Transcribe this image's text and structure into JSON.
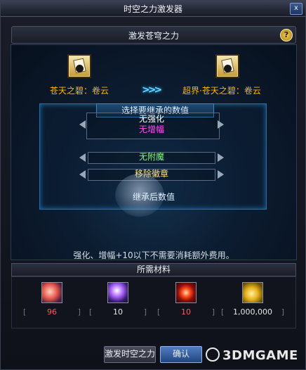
{
  "window": {
    "title": "时空之力激发器",
    "close_label": "x"
  },
  "header": {
    "title": "激发苍穹之力",
    "help_label": "?"
  },
  "items": {
    "source": {
      "name": "苍天之碧：卷云"
    },
    "target": {
      "name": "超界·苍天之碧：卷云"
    },
    "arrow_label": ">>>"
  },
  "inherit": {
    "title": "选择要继承的数值",
    "rows": [
      {
        "label": "无强化",
        "color": "#ffffff"
      },
      {
        "label": "无增幅",
        "color": "#ff4df2"
      },
      {
        "label": "无附魔",
        "color": "#7cff6b"
      },
      {
        "label": "移除徽章",
        "color": "#ffe680"
      }
    ],
    "result_label": "继承后数值"
  },
  "note": "强化、增幅+10以下不需要消耗额外费用。",
  "materials": {
    "title": "所需材料",
    "items": [
      {
        "icon": "fire-crystal-icon",
        "count": "96",
        "count_color": "#ff5a5a"
      },
      {
        "icon": "purple-orb-icon",
        "count": "10",
        "count_color": "#e6e6e6"
      },
      {
        "icon": "red-ring-icon",
        "count": "10",
        "count_color": "#ff5a5a"
      },
      {
        "icon": "gold-coins-icon",
        "count": "1,000,000",
        "count_color": "#e6e6e6"
      }
    ]
  },
  "buttons": {
    "activate": "激发时空之力",
    "confirm": "确认"
  },
  "watermark": "3DMGAME"
}
